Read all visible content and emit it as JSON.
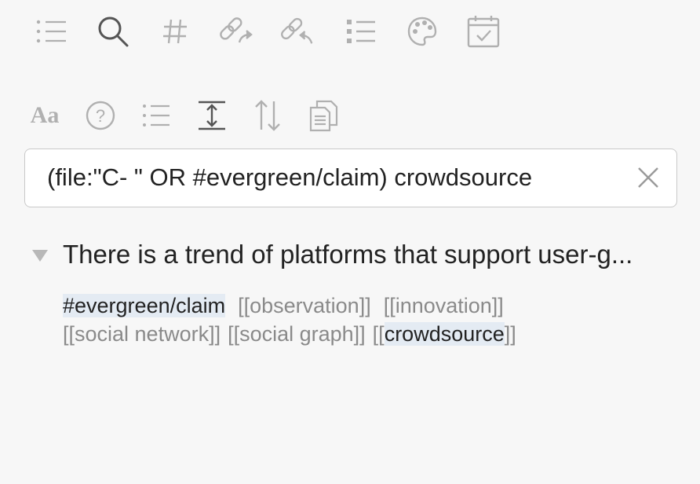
{
  "toolbar_row1": [
    {
      "icon": "list-bullets-dotted-icon"
    },
    {
      "icon": "search-icon"
    },
    {
      "icon": "hashtag-icon"
    },
    {
      "icon": "outgoing-links-icon"
    },
    {
      "icon": "backlinks-icon"
    },
    {
      "icon": "list-icon"
    },
    {
      "icon": "palette-icon"
    },
    {
      "icon": "calendar-check-icon"
    }
  ],
  "toolbar_row2": [
    {
      "icon": "text-size-icon",
      "label": "Aa"
    },
    {
      "icon": "help-icon",
      "label": "?"
    },
    {
      "icon": "list-lines-icon"
    },
    {
      "icon": "expand-vertical-icon"
    },
    {
      "icon": "sort-icon"
    },
    {
      "icon": "copy-document-icon"
    }
  ],
  "search": {
    "value": "(file:\"C- \" OR #evergreen/claim) crowdsource",
    "clear_icon": "close-icon"
  },
  "result": {
    "title": "There is a trend of platforms that support user-g...",
    "tags": {
      "tag1": "#evergreen/claim",
      "link1": "[[observation]]",
      "link2": "[[innovation]]",
      "link3": "[[social network]]",
      "link4": "[[social graph]]",
      "link5_open": "[[",
      "link5_text": "crowdsource",
      "link5_close": "]]"
    }
  },
  "colors": {
    "icon": "#a8a8a8",
    "icon_active": "#555555",
    "highlight": "#e4ebf3",
    "muted_text": "#8a8a8a"
  }
}
